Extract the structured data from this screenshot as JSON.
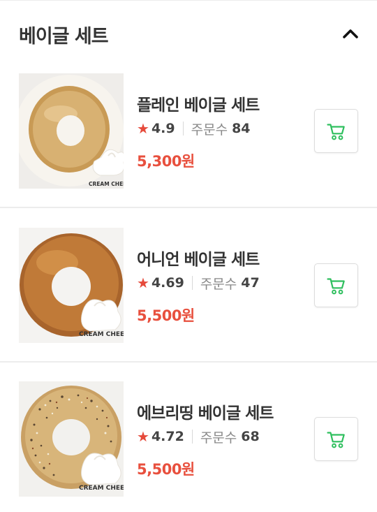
{
  "section": {
    "title": "베이글 세트"
  },
  "items": [
    {
      "name": "플레인 베이글 세트",
      "rating": "4.9",
      "orders_label": "주문수",
      "orders": "84",
      "price": "5,300원",
      "image_caption": "CREAM CHEESE"
    },
    {
      "name": "어니언 베이글 세트",
      "rating": "4.69",
      "orders_label": "주문수",
      "orders": "47",
      "price": "5,500원",
      "image_caption": "CREAM CHEESE"
    },
    {
      "name": "에브리띵 베이글 세트",
      "rating": "4.72",
      "orders_label": "주문수",
      "orders": "68",
      "price": "5,500원",
      "image_caption": "CREAM CHEESE"
    }
  ],
  "icons": {
    "collapse": "chevron-up-icon",
    "cart": "cart-icon",
    "star": "star-icon"
  },
  "colors": {
    "price": "#e8503e",
    "star": "#e64a3b",
    "cart": "#2fbf5e"
  }
}
